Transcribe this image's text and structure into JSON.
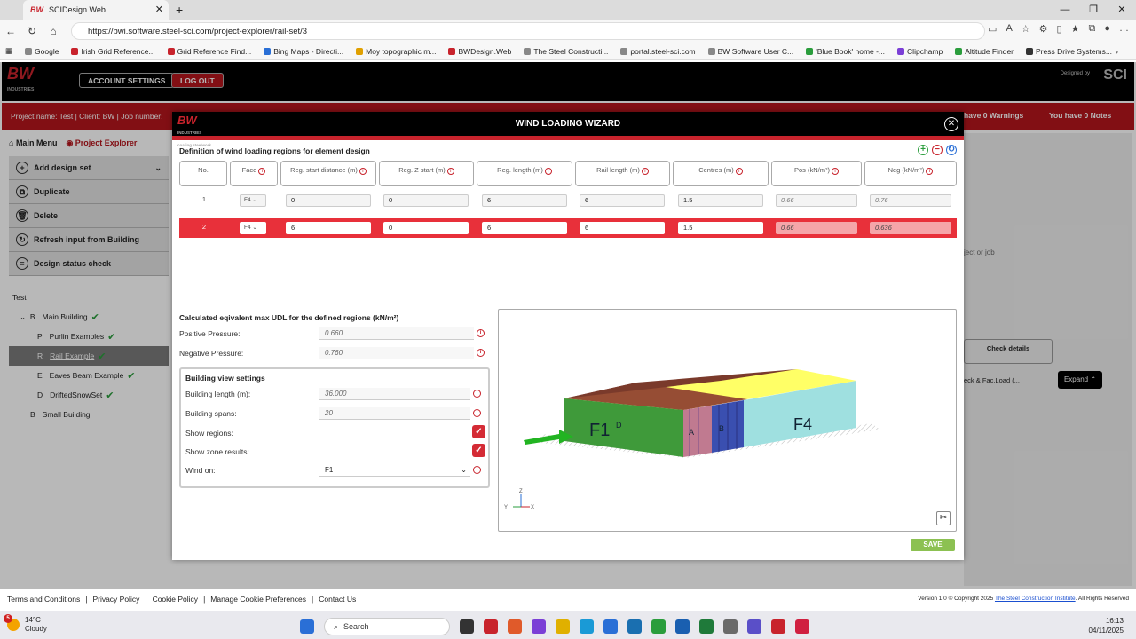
{
  "browser": {
    "tab_title": "SCIDesign.Web",
    "url": "https://bwi.software.steel-sci.com/project-explorer/rail-set/3",
    "bookmarks": [
      "Google",
      "Irish Grid Reference...",
      "Grid Reference Find...",
      "Bing Maps - Directi...",
      "Moy topographic m...",
      "BWDesign.Web",
      "The Steel Constructi...",
      "portal.steel-sci.com",
      "BW Software User C...",
      "'Blue Book' home -...",
      "Clipchamp",
      "Altitude Finder",
      "Press Drive Systems..."
    ]
  },
  "header": {
    "logo": "BW",
    "logo_sub": "INDUSTRIES",
    "logo_tag": "coating steelwork",
    "account_settings": "ACCOUNT SETTINGS",
    "log_out": "LOG OUT",
    "designed_by": "Designed by",
    "sci_logo": "SCI"
  },
  "projbar": {
    "info": "Project name: Test  |  Client: BW  |  Job number:",
    "warnings": "have 0 Warnings",
    "notes": "You have 0 Notes"
  },
  "nav": {
    "main_menu": "Main Menu",
    "project_explorer": "Project Explorer"
  },
  "sidebar": {
    "items": [
      {
        "label": "Add design set",
        "icon": "+"
      },
      {
        "label": "Duplicate",
        "icon": "⧉"
      },
      {
        "label": "Delete",
        "icon": "🗑"
      },
      {
        "label": "Refresh input from Building",
        "icon": "↻"
      },
      {
        "label": "Design status check",
        "icon": "≡"
      }
    ]
  },
  "tree": {
    "root": "Test",
    "main_building": {
      "prefix": "B",
      "label": "Main Building"
    },
    "purlin": {
      "prefix": "P",
      "label": "Purlin Examples"
    },
    "rail": {
      "prefix": "R",
      "label": "Rail Example"
    },
    "eaves": {
      "prefix": "E",
      "label": "Eaves Beam Example"
    },
    "drifted": {
      "prefix": "D",
      "label": "DriftedSnowSet"
    },
    "small": {
      "prefix": "B",
      "label": "Small Building"
    }
  },
  "rightpanel": {
    "placeholder": "ject or job",
    "check_details": "Check details",
    "dropdown": "eck & Fac.Load (...",
    "expand": "Expand"
  },
  "modal": {
    "title": "WIND LOADING WIZARD",
    "section_title": "Definition of wind loading regions for element design",
    "headers": [
      "No.",
      "Face",
      "Reg. start distance (m)",
      "Reg. Z start (m)",
      "Reg. length (m)",
      "Rail length (m)",
      "Centres (m)",
      "Pos (kN/m²)",
      "Neg (kN/m²)"
    ],
    "rows": [
      {
        "no": "1",
        "face": "F4",
        "start": "0",
        "zstart": "0",
        "length": "6",
        "rail": "6",
        "centres": "1.5",
        "pos": "0.66",
        "neg": "0.76"
      },
      {
        "no": "2",
        "face": "F4",
        "start": "6",
        "zstart": "0",
        "length": "6",
        "rail": "6",
        "centres": "1.5",
        "pos": "0.66",
        "neg": "0.636"
      }
    ],
    "udl_title": "Calculated eqivalent max UDL for the defined regions (kN/m²)",
    "positive_label": "Positive Pressure:",
    "positive_value": "0.660",
    "negative_label": "Negative Pressure:",
    "negative_value": "0.760",
    "settings_title": "Building view settings",
    "building_length_label": "Building length (m):",
    "building_length_value": "36.000",
    "building_spans_label": "Building spans:",
    "building_spans_value": "20",
    "show_regions_label": "Show regions:",
    "show_zone_label": "Show zone results:",
    "wind_on_label": "Wind on:",
    "wind_on_value": "F1",
    "save": "SAVE"
  },
  "viewer": {
    "face_f1": "F1",
    "face_f4": "F4",
    "zone_d": "D",
    "zone_a": "A",
    "zone_b": "B",
    "axis_z": "Z",
    "axis_y": "Y",
    "axis_x": "X"
  },
  "footer": {
    "links": [
      "Terms and Conditions",
      "Privacy Policy",
      "Cookie Policy",
      "Manage Cookie Preferences",
      "Contact Us"
    ],
    "version": "Version 1.0 © Copyright 2025",
    "sci_link": "The Steel Construction Institute",
    "rights": ". All Rights Reserved"
  },
  "taskbar": {
    "temp": "14°C",
    "condition": "Cloudy",
    "search": "Search",
    "time": "16:13",
    "date": "04/11/2025",
    "badge": "5"
  }
}
